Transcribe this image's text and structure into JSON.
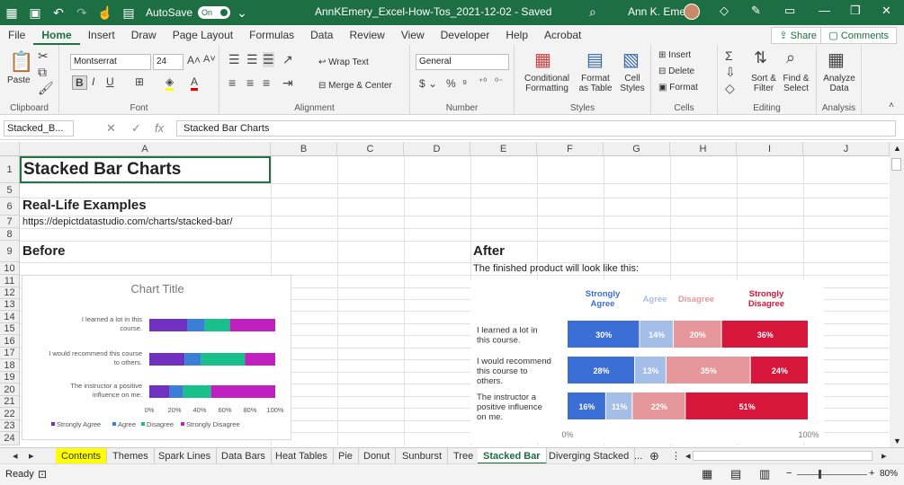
{
  "titlebar": {
    "autosave": "AutoSave",
    "toggle": "On",
    "document": "AnnKEmery_Excel-How-Tos_2021-12-02  -  Saved",
    "user": "Ann K. Emery"
  },
  "menu": [
    "File",
    "Home",
    "Insert",
    "Draw",
    "Page Layout",
    "Formulas",
    "Data",
    "Review",
    "View",
    "Developer",
    "Help",
    "Acrobat"
  ],
  "share": "Share",
  "comments": "Comments",
  "ribbon": {
    "paste": "Paste",
    "clipboard": "Clipboard",
    "font_name": "Montserrat",
    "font_size": "24",
    "font": "Font",
    "wrap": "Wrap Text",
    "merge": "Merge & Center",
    "alignment": "Alignment",
    "numfmt": "General",
    "number": "Number",
    "cond": "Conditional Formatting",
    "fmt_table": "Format as Table",
    "cell_styles": "Cell Styles",
    "styles": "Styles",
    "insert": "Insert",
    "delete": "Delete",
    "format": "Format",
    "cells": "Cells",
    "sort": "Sort & Filter",
    "find": "Find & Select",
    "editing": "Editing",
    "analyze": "Analyze Data",
    "analysis": "Analysis"
  },
  "formula": {
    "namebox": "Stacked_B...",
    "fx": "fx",
    "value": "Stacked Bar Charts"
  },
  "columns": [
    "A",
    "B",
    "C",
    "D",
    "E",
    "F",
    "G",
    "H",
    "I",
    "J"
  ],
  "rows": [
    "1",
    "5",
    "6",
    "7",
    "8",
    "9",
    "10",
    "11",
    "12",
    "13",
    "14",
    "15",
    "16",
    "17",
    "18",
    "19",
    "20",
    "21",
    "22",
    "23",
    "24"
  ],
  "cells": {
    "title": "Stacked Bar Charts",
    "reallife": "Real-Life Examples",
    "url": "https://depictdatastudio.com/charts/stacked-bar/",
    "before": "Before",
    "after": "After",
    "after_note": "The finished product will look like this:"
  },
  "chart_data": [
    {
      "type": "bar",
      "orientation": "horizontal",
      "stacked": true,
      "title": "Chart Title",
      "categories": [
        "I learned a lot in this course.",
        "I would recommend this course to others.",
        "The instructor a positive influence on me."
      ],
      "series": [
        {
          "name": "Strongly Agree",
          "color": "#7030c0",
          "values": [
            30,
            28,
            16
          ]
        },
        {
          "name": "Agree",
          "color": "#3a7fd5",
          "values": [
            14,
            13,
            11
          ]
        },
        {
          "name": "Disagree",
          "color": "#19c089",
          "values": [
            20,
            35,
            22
          ]
        },
        {
          "name": "Strongly Disagree",
          "color": "#c020c0",
          "values": [
            36,
            24,
            51
          ]
        }
      ],
      "xticks": [
        "0%",
        "20%",
        "40%",
        "60%",
        "80%",
        "100%"
      ],
      "xlim": [
        0,
        100
      ],
      "legend": "bottom"
    },
    {
      "type": "bar",
      "orientation": "horizontal",
      "stacked": true,
      "categories": [
        "I learned a lot in this course.",
        "I would recommend this course to others.",
        "The instructor a positive influence on me."
      ],
      "series": [
        {
          "name": "Strongly Agree",
          "color": "#3b6fd6",
          "values": [
            30,
            28,
            16
          ]
        },
        {
          "name": "Agree",
          "color": "#a5bee8",
          "values": [
            14,
            13,
            11
          ]
        },
        {
          "name": "Disagree",
          "color": "#e5979c",
          "values": [
            20,
            35,
            22
          ]
        },
        {
          "name": "Strongly Disagree",
          "color": "#d6163a",
          "values": [
            36,
            24,
            51
          ]
        }
      ],
      "xticks": [
        "0%",
        "100%"
      ],
      "xlim": [
        0,
        100
      ],
      "legend": "top"
    }
  ],
  "tabs": [
    "Contents",
    "Themes",
    "Spark Lines",
    "Data Bars",
    "Heat Tables",
    "Pie",
    "Donut",
    "Sunburst",
    "Tree",
    "Stacked Bar",
    "Diverging Stacked",
    "..."
  ],
  "status": {
    "ready": "Ready",
    "zoom": "80%"
  }
}
